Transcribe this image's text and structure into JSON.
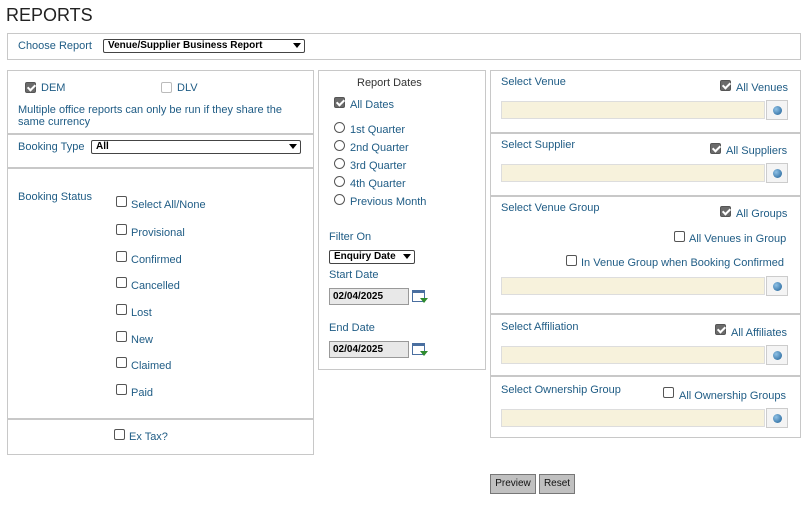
{
  "page": {
    "title": "REPORTS"
  },
  "report_bar": {
    "label": "Choose Report",
    "selected": "Venue/Supplier Business Report"
  },
  "offices": {
    "dem": {
      "label": "DEM",
      "checked": true
    },
    "dlv": {
      "label": "DLV",
      "checked": false
    },
    "note": "Multiple office reports can only be run if they share the same currency"
  },
  "booking_type": {
    "label": "Booking Type",
    "selected": "All"
  },
  "booking_status": {
    "label": "Booking Status",
    "items": [
      {
        "label": "Select All/None"
      },
      {
        "label": "Provisional"
      },
      {
        "label": "Confirmed"
      },
      {
        "label": "Cancelled"
      },
      {
        "label": "Lost"
      },
      {
        "label": "New"
      },
      {
        "label": "Claimed"
      },
      {
        "label": "Paid"
      }
    ]
  },
  "ex_tax": {
    "label": "Ex Tax?"
  },
  "dates": {
    "title": "Report Dates",
    "all_dates": "All Dates",
    "options": [
      "1st Quarter",
      "2nd Quarter",
      "3rd Quarter",
      "4th Quarter",
      "Previous Month"
    ],
    "filter_on_label": "Filter On",
    "filter_on_value": "Enquiry Date",
    "start_label": "Start Date",
    "start_value": "02/04/2025",
    "end_label": "End Date",
    "end_value": "02/04/2025"
  },
  "venue": {
    "label": "Select Venue",
    "all_label": "All Venues"
  },
  "supplier": {
    "label": "Select Supplier",
    "all_label": "All Suppliers"
  },
  "venue_group": {
    "label": "Select Venue Group",
    "all_label": "All Groups",
    "all_in_group": "All Venues in Group",
    "in_group_when_confirmed": "In Venue Group when Booking Confirmed"
  },
  "affiliation": {
    "label": "Select Affiliation",
    "all_label": "All Affiliates"
  },
  "ownership": {
    "label": "Select Ownership Group",
    "all_label": "All Ownership Groups"
  },
  "actions": {
    "preview": "Preview",
    "reset": "Reset"
  },
  "colors": {
    "label_blue": "#1f5c85",
    "field_bg": "#f7f2dc",
    "button_bg": "#c0c0c0"
  }
}
